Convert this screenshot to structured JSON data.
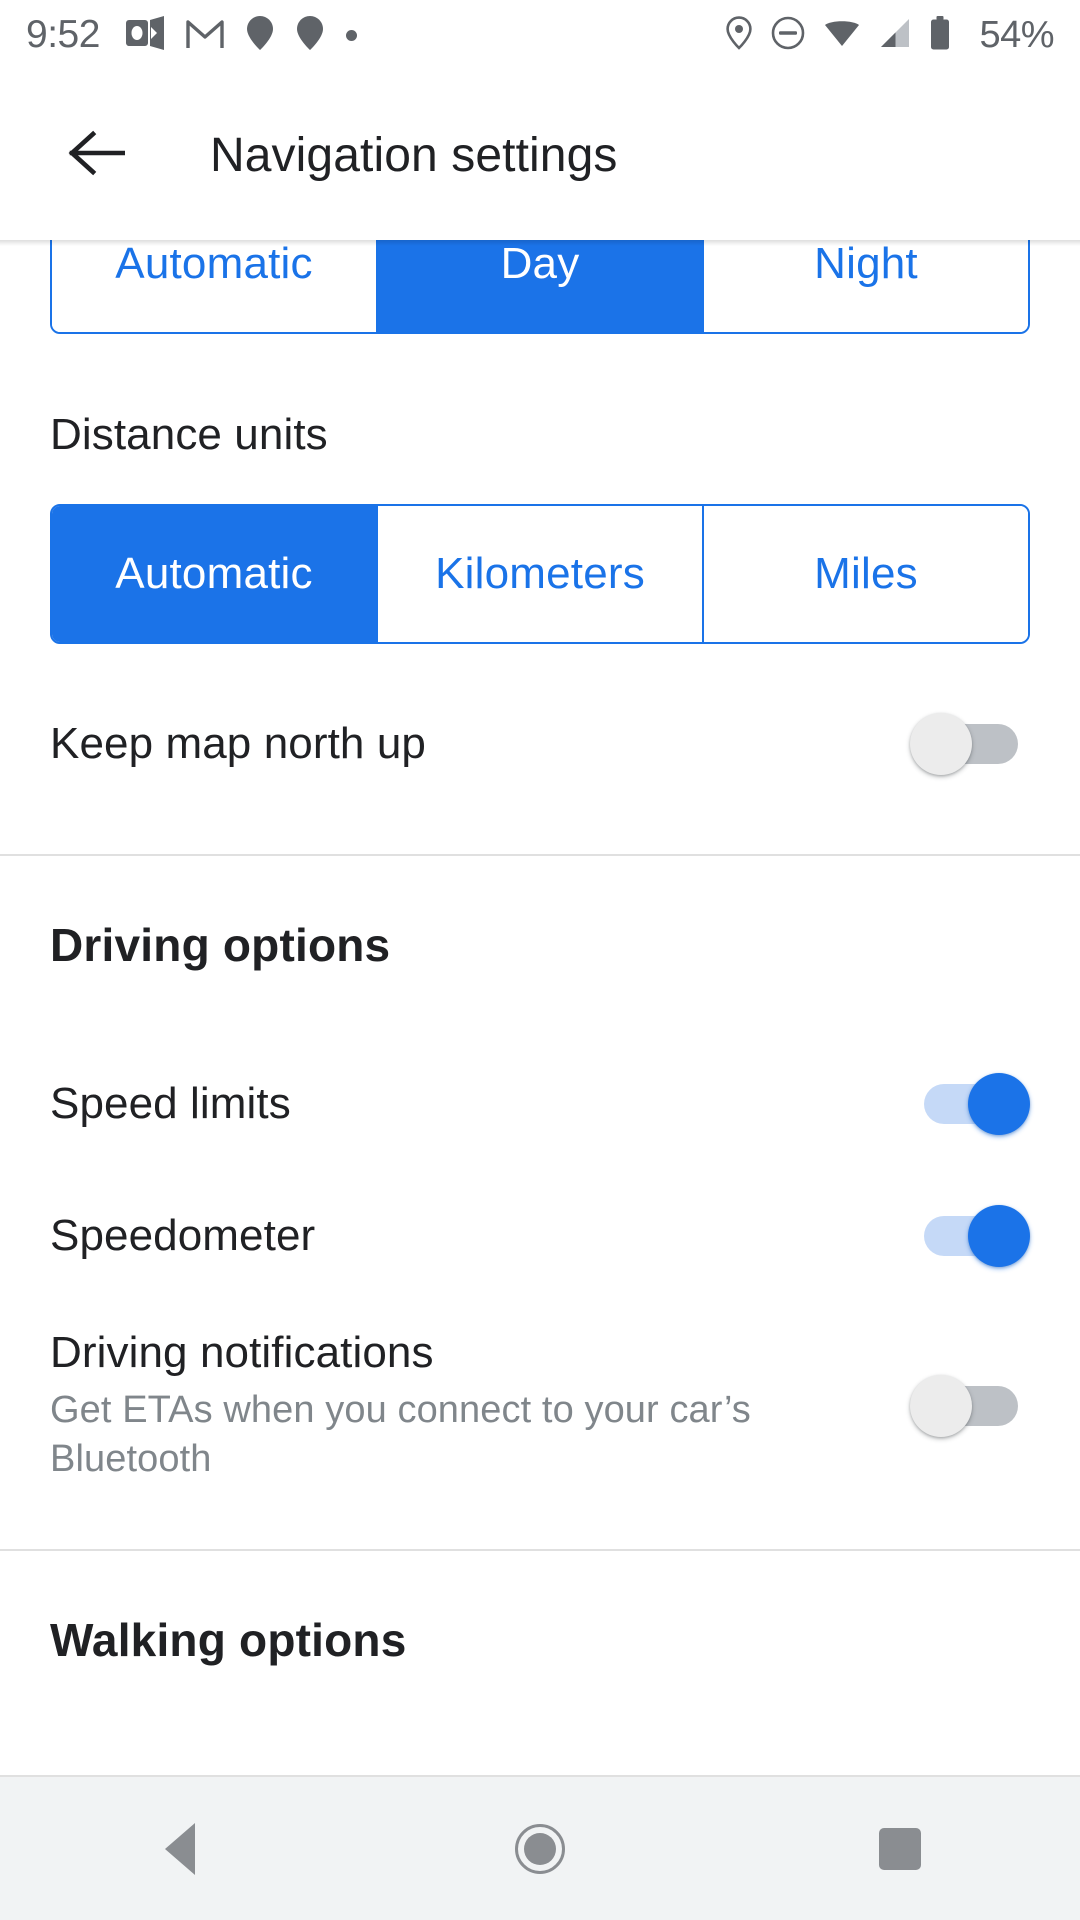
{
  "status_bar": {
    "time": "9:52",
    "battery_percent": "54%",
    "left_icons": [
      "outlook-icon",
      "gmail-icon",
      "location-pin-icon",
      "location-pin-icon",
      "dot-icon"
    ],
    "right_icons": [
      "location-icon",
      "do-not-disturb-icon",
      "wifi-icon",
      "cellular-signal-icon",
      "battery-icon"
    ]
  },
  "app_bar": {
    "back_icon": "back-arrow-icon",
    "title": "Navigation settings"
  },
  "map_display": {
    "options": [
      "Automatic",
      "Day",
      "Night"
    ],
    "selected": "Day"
  },
  "distance_units": {
    "label": "Distance units",
    "options": [
      "Automatic",
      "Kilometers",
      "Miles"
    ],
    "selected": "Automatic"
  },
  "keep_map_north_up": {
    "title": "Keep map north up",
    "state": "off"
  },
  "driving_options": {
    "heading": "Driving options",
    "rows": [
      {
        "title": "Speed limits",
        "subtitle": "",
        "state": "on"
      },
      {
        "title": "Speedometer",
        "subtitle": "",
        "state": "on"
      },
      {
        "title": "Driving notifications",
        "subtitle": "Get ETAs when you connect to your car’s Bluetooth",
        "state": "off"
      }
    ]
  },
  "walking_options": {
    "heading": "Walking options"
  },
  "nav_bar": {
    "back": "back-triangle-icon",
    "home": "home-circle-icon",
    "recents": "recents-square-icon"
  },
  "colors": {
    "accent": "#1b73e8",
    "text_primary": "#202124",
    "text_secondary": "#80868b",
    "toggle_off_track": "#bdc1c6",
    "toggle_on_track": "#c5d9f7",
    "nav_bar_bg": "#f1f3f4"
  }
}
